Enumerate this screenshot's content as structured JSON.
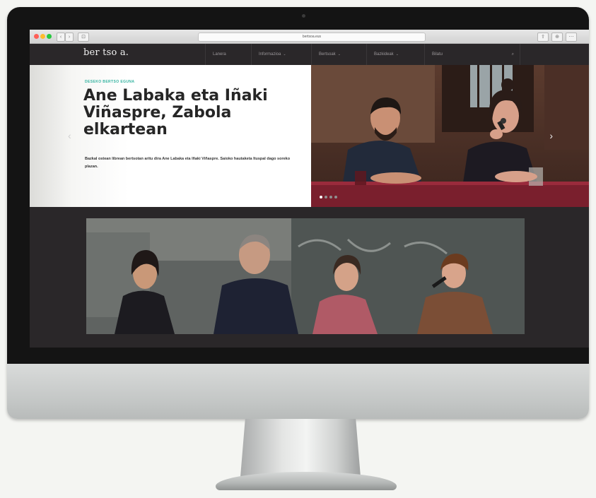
{
  "browser": {
    "url": "bertsoa.eus",
    "nav_glyphs": [
      "‹",
      "›"
    ],
    "tab_glyph": "⊡",
    "right_glyphs": [
      "⇪",
      "⊕",
      "⋯"
    ]
  },
  "site": {
    "logo": "ber tso a.",
    "nav": [
      {
        "label": "Lanera",
        "has_menu": false
      },
      {
        "label": "Informazioa",
        "has_menu": true
      },
      {
        "label": "Bertsoak",
        "has_menu": true
      },
      {
        "label": "Bazkideak",
        "has_menu": true
      },
      {
        "label": "Bilatu",
        "has_menu": false
      }
    ],
    "chevron": "⌄"
  },
  "hero": {
    "kicker": "DESEKO BERTSO EGUNA",
    "headline": "Ane Labaka eta Iñaki Viñaspre, Zabola elkartean",
    "lede": "Bazkal ostean librean bertsotan aritu dira Ane Labaka eta Iñaki Viñaspre. Saioko hautaketa Ituspal dago soreko plazan.",
    "prev_arrow": "‹",
    "next_arrow": "›",
    "slides_total": 4,
    "slide_active": 1
  },
  "colors": {
    "nav_bg": "#2a2729",
    "kicker": "#34b3a0",
    "headline": "#262626"
  }
}
